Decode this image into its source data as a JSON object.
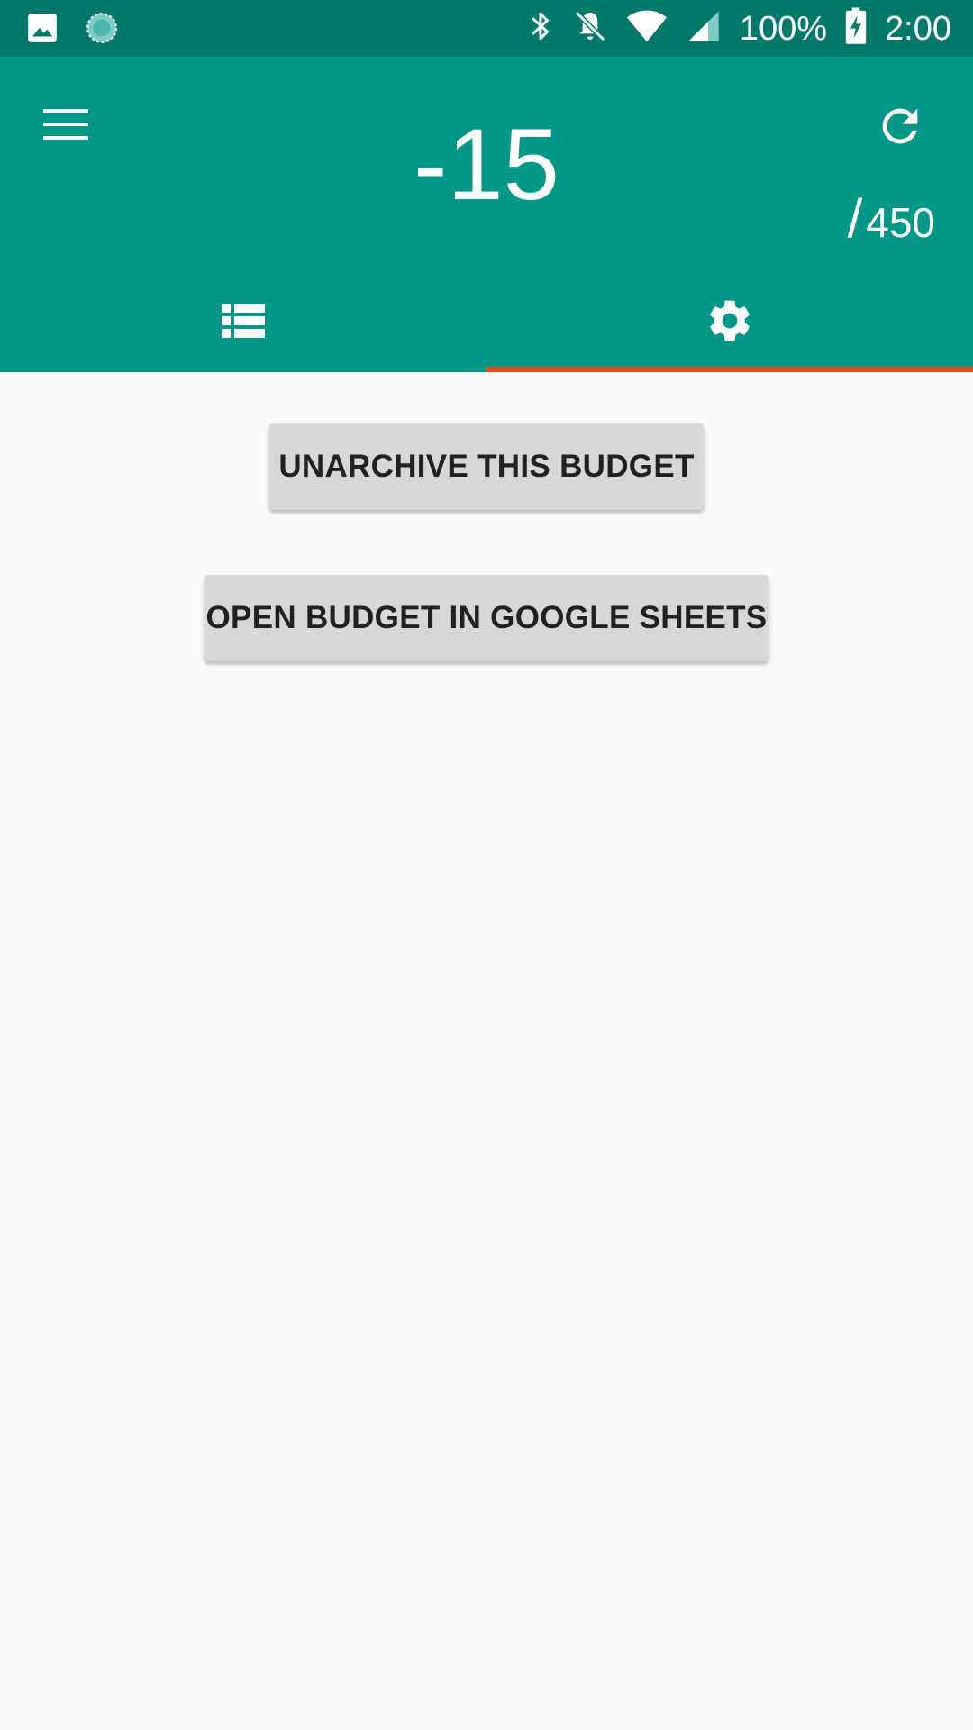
{
  "status_bar": {
    "left_icons": [
      "image-icon",
      "sync-circle-icon"
    ],
    "right_icons": [
      "bluetooth-icon",
      "notifications-off-icon",
      "wifi-icon",
      "cell-signal-icon",
      "battery-charging-icon"
    ],
    "battery": "100%",
    "time": "2:00"
  },
  "header": {
    "balance": "-15",
    "total_slash": "/",
    "total_value": "450",
    "menu_icon": "menu-icon",
    "refresh_icon": "refresh-icon",
    "background_color": "#009688",
    "status_bar_color": "#00796b",
    "indicator_color": "#e64a19"
  },
  "tabs": [
    {
      "icon": "list-icon",
      "selected": false
    },
    {
      "icon": "settings-gear-icon",
      "selected": true
    }
  ],
  "actions": {
    "unarchive_label": "UNARCHIVE THIS BUDGET",
    "open_sheets_label": "OPEN BUDGET IN GOOGLE SHEETS"
  }
}
